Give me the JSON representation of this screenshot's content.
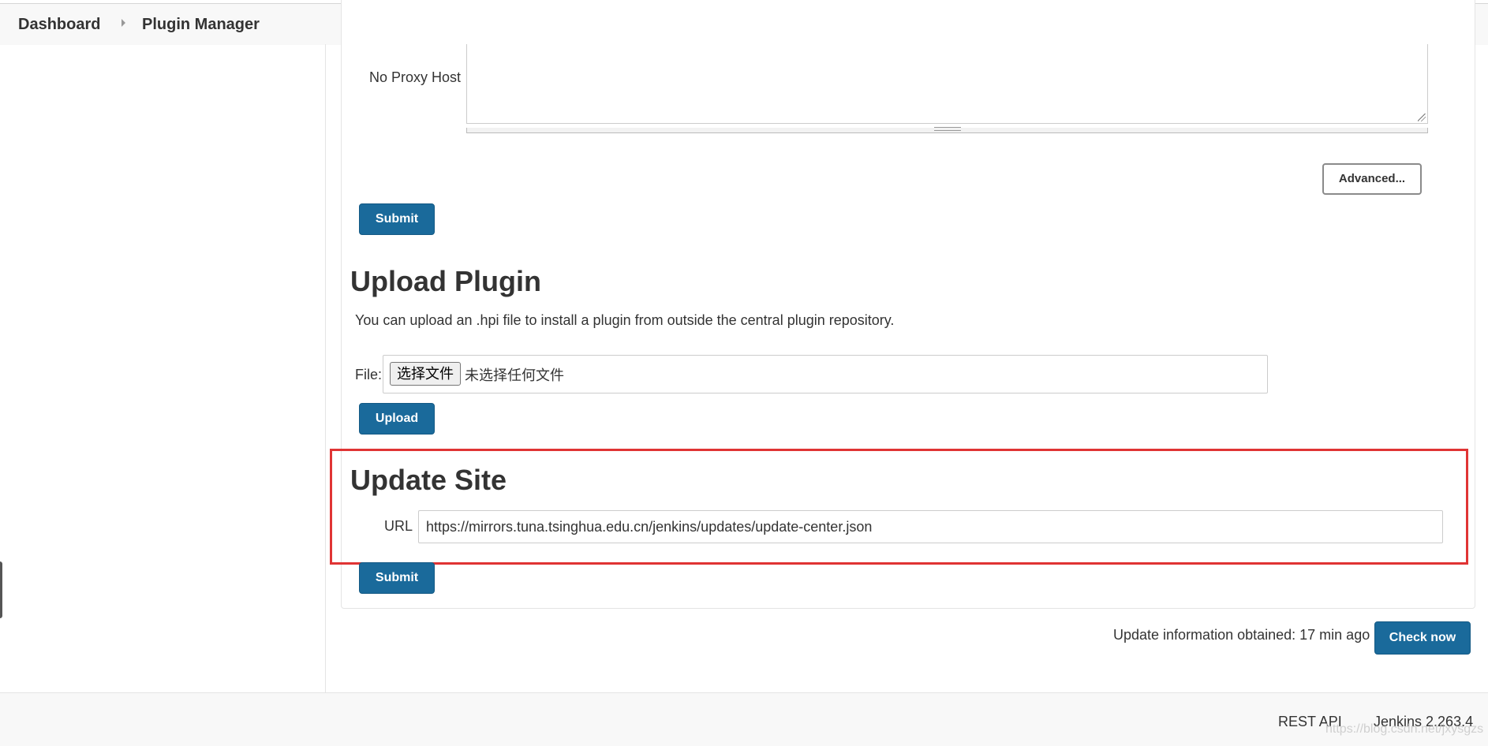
{
  "breadcrumb": {
    "items": [
      {
        "label": "Dashboard"
      },
      {
        "label": "Plugin Manager"
      }
    ]
  },
  "proxy": {
    "no_proxy_host_label": "No Proxy Host",
    "no_proxy_host_value": "",
    "advanced_label": "Advanced...",
    "submit_label": "Submit"
  },
  "upload": {
    "title": "Upload Plugin",
    "description": "You can upload an .hpi file to install a plugin from outside the central plugin repository.",
    "file_label": "File:",
    "choose_file_label": "选择文件",
    "no_file_text": "未选择任何文件",
    "upload_label": "Upload"
  },
  "update_site": {
    "title": "Update Site",
    "url_label": "URL",
    "url_value": "https://mirrors.tuna.tsinghua.edu.cn/jenkins/updates/update-center.json",
    "submit_label": "Submit"
  },
  "status": {
    "update_info": "Update information obtained: 17 min ago",
    "check_now_label": "Check now"
  },
  "footer": {
    "rest_api_label": "REST API",
    "version": "Jenkins 2.263.4"
  },
  "watermark": "https://blog.csdn.net/jxysgzs",
  "colors": {
    "primary_button": "#1a6a9b",
    "highlight_border": "#e03434"
  }
}
